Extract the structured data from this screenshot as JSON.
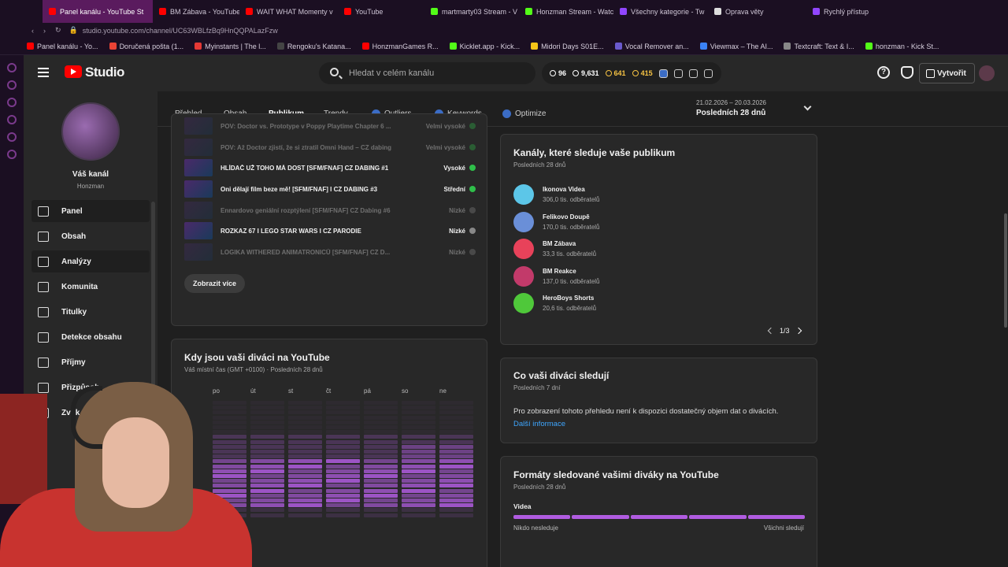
{
  "browser": {
    "tabs": [
      {
        "label": "Panel kanálu - YouTube St",
        "color": "#ff0000",
        "active": true
      },
      {
        "label": "BM Zábava - YouTube",
        "color": "#ff0000"
      },
      {
        "label": "WAIT WHAT Momenty v",
        "color": "#ff0000"
      },
      {
        "label": "YouTube",
        "color": "#ff0000"
      },
      {
        "label": "martmarty03 Stream - V",
        "color": "#53fc18"
      },
      {
        "label": "Honzman Stream - Watc",
        "color": "#53fc18"
      },
      {
        "label": "Všechny kategorie - Tw",
        "color": "#9146ff"
      },
      {
        "label": "Oprava věty",
        "color": "#dddddd"
      },
      {
        "label": "Rychlý přístup",
        "color": "#9146ff"
      }
    ],
    "url": "studio.youtube.com/channel/UC63WBLfzBq9HnQQPALazFzw",
    "bookmarks": [
      {
        "label": "Panel kanálu - Yo...",
        "color": "#ff0000"
      },
      {
        "label": "Doručená pošta (1...",
        "color": "#ea4335"
      },
      {
        "label": "Myinstants | The l...",
        "color": "#e53935"
      },
      {
        "label": "Rengoku's Katana...",
        "color": "#444444"
      },
      {
        "label": "HonzmanGames R...",
        "color": "#ff0000"
      },
      {
        "label": "Kicklet.app - Kick...",
        "color": "#53fc18"
      },
      {
        "label": "Midori Days S01E...",
        "color": "#f5c518"
      },
      {
        "label": "Vocal Remover an...",
        "color": "#6a5acd"
      },
      {
        "label": "Viewmax – The AI...",
        "color": "#3b82f6"
      },
      {
        "label": "Textcraft: Text & I...",
        "color": "#888888"
      },
      {
        "label": "honzman - Kick St...",
        "color": "#53fc18"
      }
    ]
  },
  "header": {
    "studio_label": "Studio",
    "search_placeholder": "Hledat v celém kanálu",
    "stats": [
      {
        "value": "96",
        "color": "#ffffff"
      },
      {
        "value": "9,631",
        "color": "#ffffff"
      },
      {
        "value": "641",
        "color": "#f6c343"
      },
      {
        "value": "415",
        "color": "#f6c343"
      }
    ],
    "create_label": "Vytvořit"
  },
  "sidebar": {
    "channel_title": "Váš kanál",
    "channel_name": "Honzman",
    "items": [
      {
        "label": "Panel",
        "active": true
      },
      {
        "label": "Obsah"
      },
      {
        "label": "Analýzy",
        "active": true
      },
      {
        "label": "Komunita"
      },
      {
        "label": "Titulky"
      },
      {
        "label": "Detekce obsahu"
      },
      {
        "label": "Příjmy"
      },
      {
        "label": "Přizpůsob"
      },
      {
        "label": "Zvuk"
      }
    ]
  },
  "tabs": {
    "items": [
      "Přehled",
      "Obsah",
      "Publikum",
      "Trendy",
      "Outliers",
      "Keywords",
      "Optimize"
    ],
    "selected": "Publikum",
    "date_range": "21.02.2026 – 20.03.2026",
    "period": "Posledních 28 dnů"
  },
  "videos_card": {
    "rows": [
      {
        "title": "POV: Doctor vs. Prototype v Poppy Playtime Chapter 6 ...",
        "level": "Velmi vysoké",
        "dim": true,
        "color": "#2fbf4a"
      },
      {
        "title": "POV: Až Doctor zjistí, že si ztratil Omni Hand – CZ dabing",
        "level": "Velmi vysoké",
        "dim": true,
        "color": "#2fbf4a"
      },
      {
        "title": "HLÍDAČ UŽ TOHO MÁ DOST [SFM/FNAF] CZ DABING #1",
        "level": "Vysoké",
        "dim": false,
        "color": "#2fbf4a"
      },
      {
        "title": "Oni dělají film beze mě! [SFM/FNAF] I CZ DABING #3",
        "level": "Střední",
        "dim": false,
        "color": "#2fbf4a"
      },
      {
        "title": "Ennardovo geniální rozptýlení [SFM/FNAF] CZ Dabing #6",
        "level": "Nízké",
        "dim": true,
        "color": "#888888"
      },
      {
        "title": "ROZKAZ 67 I LEGO STAR WARS I CZ PARODIE",
        "level": "Nízké",
        "dim": false,
        "color": "#888888"
      },
      {
        "title": "LOGIKA WITHERED ANIMATRONICŮ [SFM/FNAF] CZ D...",
        "level": "Nízké",
        "dim": true,
        "color": "#888888"
      }
    ],
    "more_label": "Zobrazit více"
  },
  "channels_card": {
    "title": "Kanály, které sleduje vaše publikum",
    "subtitle": "Posledních 28 dnů",
    "channels": [
      {
        "name": "Ikonova Videa",
        "subs": "306,0 tis. odběratelů",
        "color": "#5cc6e8"
      },
      {
        "name": "Felikovo Doupě",
        "subs": "170,0 tis. odběratelů",
        "color": "#6a8fd8"
      },
      {
        "name": "BM Zábava",
        "subs": "33,3 tis. odběratelů",
        "color": "#e8425a"
      },
      {
        "name": "BM Reakce",
        "subs": "137,0 tis. odběratelů",
        "color": "#c23a6a"
      },
      {
        "name": "HeroBoys Shorts",
        "subs": "20,6 tis. odběratelů",
        "color": "#4fc83a"
      }
    ],
    "page": "1/3"
  },
  "when_card": {
    "title": "Kdy jsou vaši diváci na YouTube",
    "subtitle": "Váš místní čas (GMT +0100) · Posledních 28 dnů",
    "days": [
      "po",
      "út",
      "st",
      "čt",
      "pá",
      "so",
      "ne"
    ]
  },
  "watching_card": {
    "title": "Co vaši diváci sledují",
    "subtitle": "Posledních 7 dní",
    "message": "Pro zobrazení tohoto přehledu není k dispozici dostatečný objem dat o divácích.",
    "link": "Další informace"
  },
  "formats_card": {
    "title": "Formáty sledované vašimi diváky na YouTube",
    "subtitle": "Posledních 28 dnů",
    "format_label": "Videa",
    "left_label": "Nikdo nesleduje",
    "right_label": "Všichni sledují"
  }
}
